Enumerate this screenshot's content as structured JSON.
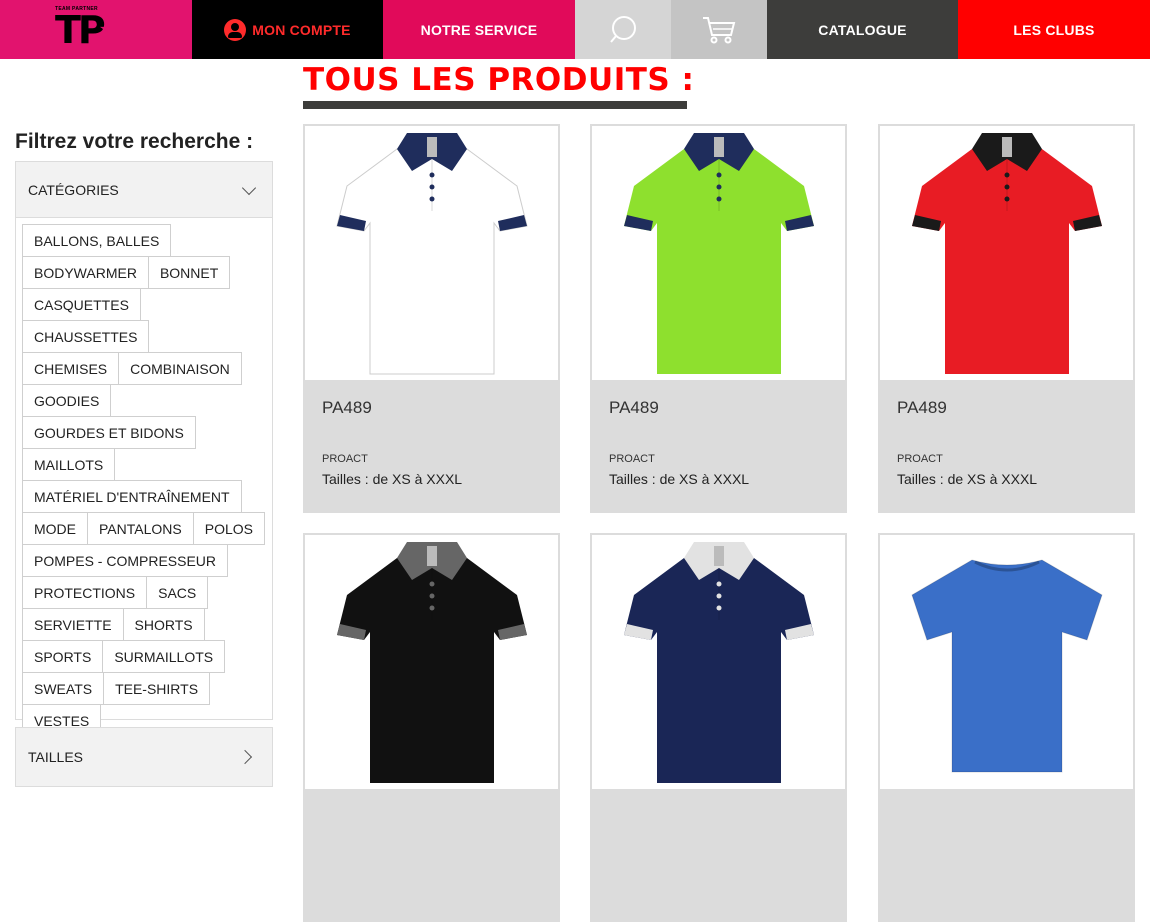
{
  "nav": {
    "logo_small": "TEAM PARTNER",
    "logo_mark": "TP",
    "account": "MON COMPTE",
    "service": "NOTRE SERVICE",
    "catalogue": "CATALOGUE",
    "clubs": "LES CLUBS",
    "icons": [
      "user-icon",
      "search-icon",
      "cart-icon"
    ]
  },
  "page_title": "TOUS LES PRODUITS :",
  "sidebar": {
    "title": "Filtrez votre recherche :",
    "categories_label": "CATÉGORIES",
    "categories": [
      "BALLONS, BALLES",
      "BODYWARMER",
      "BONNET",
      "CASQUETTES",
      "CHAUSSETTES",
      "CHEMISES",
      "COMBINAISON",
      "GOODIES",
      "GOURDES ET BIDONS",
      "MAILLOTS",
      "MATÉRIEL D'ENTRAÎNEMENT",
      "MODE",
      "PANTALONS",
      "POLOS",
      "POMPES - COMPRESSEUR",
      "PROTECTIONS",
      "SACS",
      "SERVIETTE",
      "SHORTS",
      "SPORTS",
      "SURMAILLOTS",
      "SWEATS",
      "TEE-SHIRTS",
      "VESTES"
    ],
    "sizes_label": "TAILLES"
  },
  "products": [
    {
      "ref": "PA489",
      "brand": "PROACT",
      "sizes": "Tailles : de XS à XXXL",
      "body": "#ffffff",
      "trim": "#1f2d5c",
      "kind": "polo"
    },
    {
      "ref": "PA489",
      "brand": "PROACT",
      "sizes": "Tailles : de XS à XXXL",
      "body": "#8ee02e",
      "trim": "#1f2d5c",
      "kind": "polo"
    },
    {
      "ref": "PA489",
      "brand": "PROACT",
      "sizes": "Tailles : de XS à XXXL",
      "body": "#e81c24",
      "trim": "#1a1a1a",
      "kind": "polo"
    },
    {
      "ref": "",
      "brand": "",
      "sizes": "",
      "body": "#111111",
      "trim": "#666666",
      "kind": "polo"
    },
    {
      "ref": "",
      "brand": "",
      "sizes": "",
      "body": "#1a2656",
      "trim": "#e2e2e2",
      "kind": "polo"
    },
    {
      "ref": "",
      "brand": "",
      "sizes": "",
      "body": "#3a6fc8",
      "trim": "#3a6fc8",
      "kind": "tee"
    }
  ]
}
